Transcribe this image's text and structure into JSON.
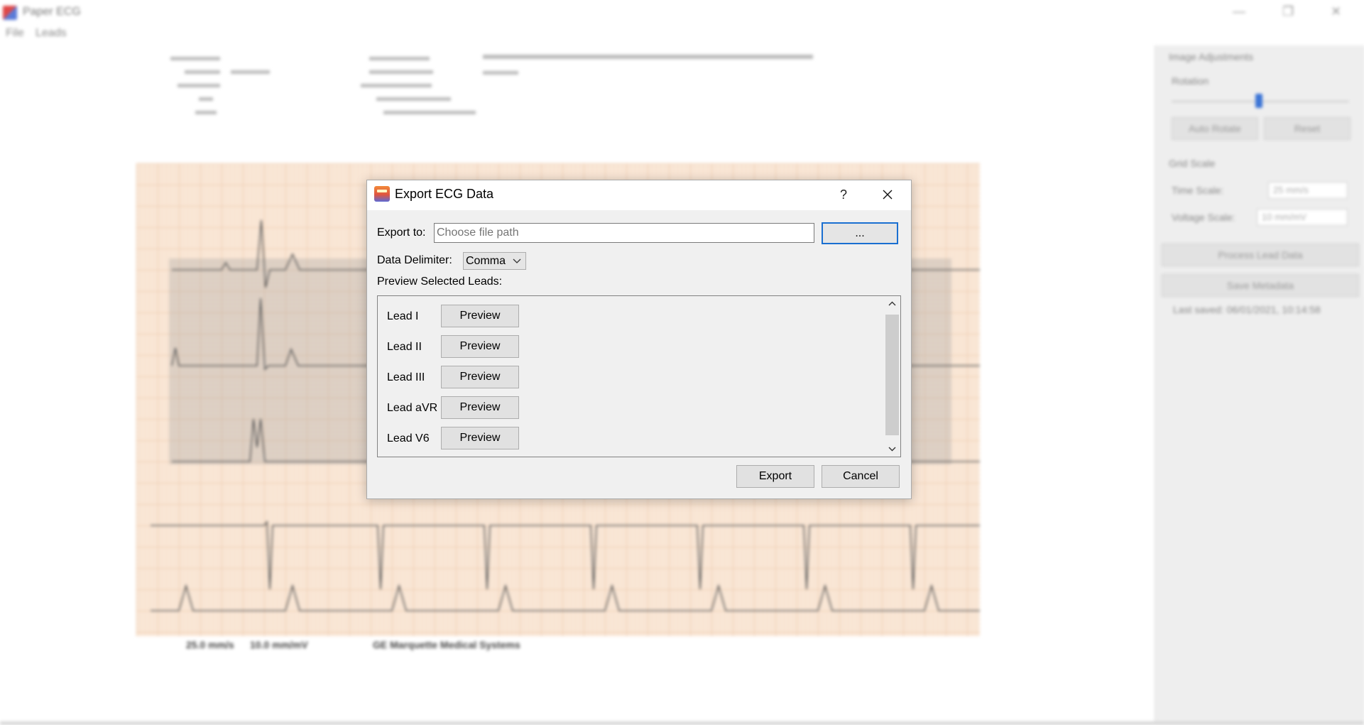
{
  "app": {
    "title": "Paper ECG",
    "menu": [
      "File",
      "Leads"
    ],
    "window_controls": [
      "—",
      "❐",
      "✕"
    ]
  },
  "ecg_image": {
    "footer": [
      "25.0 mm/s",
      "10.0 mm/mV",
      "GE Marquette Medical Systems"
    ]
  },
  "side_panel": {
    "header": "Image Adjustments",
    "rotation_label": "Rotation",
    "auto_rotate": "Auto Rotate",
    "reset": "Reset",
    "grid_scale_header": "Grid Scale",
    "time_scale_label": "Time Scale:",
    "time_scale_value": "25 mm/s",
    "voltage_scale_label": "Voltage Scale:",
    "voltage_scale_value": "10 mm/mV",
    "process_button": "Process Lead Data",
    "save_metadata_button": "Save Metadata",
    "last_saved": "Last saved: 06/01/2021, 10:14:58"
  },
  "dialog": {
    "title": "Export ECG Data",
    "help": "?",
    "export_to_label": "Export to:",
    "file_path_placeholder": "Choose file path",
    "browse_label": "...",
    "delimiter_label": "Data Delimiter:",
    "delimiter_value": "Comma",
    "preview_heading": "Preview Selected Leads:",
    "leads": [
      {
        "name": "Lead I",
        "button": "Preview"
      },
      {
        "name": "Lead II",
        "button": "Preview"
      },
      {
        "name": "Lead III",
        "button": "Preview"
      },
      {
        "name": "Lead aVR",
        "button": "Preview"
      },
      {
        "name": "Lead V6",
        "button": "Preview"
      }
    ],
    "export_button": "Export",
    "cancel_button": "Cancel"
  }
}
